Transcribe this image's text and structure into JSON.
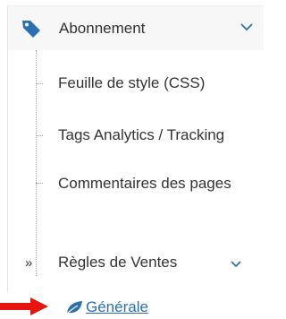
{
  "menu": {
    "top": {
      "label": "Abonnement",
      "icon": "tag-icon",
      "expanded": true
    },
    "items": [
      {
        "label": "Feuille de style (CSS)"
      },
      {
        "label": "Tags Analytics / Tracking"
      },
      {
        "label": "Commentaires des pages"
      }
    ],
    "regles": {
      "marker": "»",
      "label": "Règles de Ventes",
      "expanded": true
    },
    "generale": {
      "label": "Générale",
      "icon": "leaf-icon"
    }
  },
  "colors": {
    "icon_blue": "#2a6fb0",
    "link_blue": "#2a6fb0",
    "arrow_red": "#e8140f",
    "text": "#333333"
  }
}
